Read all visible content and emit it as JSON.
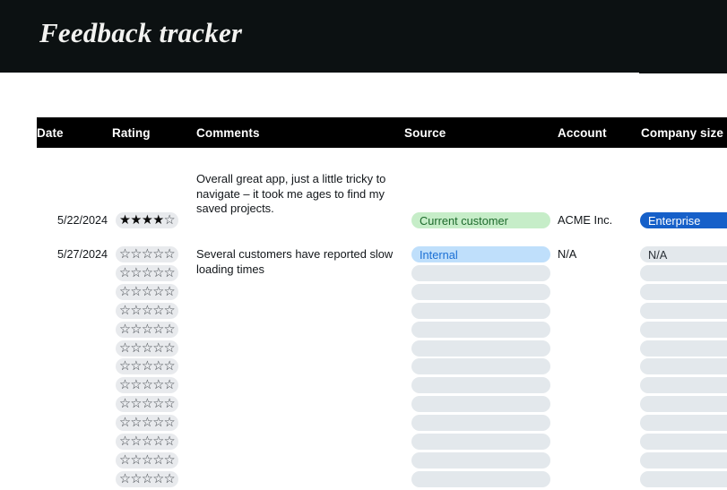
{
  "app": {
    "title": "Feedback tracker",
    "banner_color": "#0c1112"
  },
  "table": {
    "columns": [
      {
        "key": "date",
        "label": "Date"
      },
      {
        "key": "rating",
        "label": "Rating"
      },
      {
        "key": "comments",
        "label": "Comments"
      },
      {
        "key": "source",
        "label": "Source"
      },
      {
        "key": "account",
        "label": "Account"
      },
      {
        "key": "company",
        "label": "Company size"
      }
    ],
    "header_background": "#000000",
    "rows": [
      {
        "date": "5/22/2024",
        "rating": 4,
        "rating_max": 5,
        "comments": "Overall great app, just a little tricky to navigate – it took me ages to find my saved projects.",
        "source": "Current customer",
        "source_style": "green",
        "account": "ACME Inc.",
        "company": "Enterprise",
        "company_style": "navy"
      },
      {
        "date": "5/27/2024",
        "rating": 0,
        "rating_max": 5,
        "comments": "Several customers have reported slow loading times",
        "source": "Internal",
        "source_style": "blue",
        "account": "N/A",
        "company": "N/A",
        "company_style": "gray"
      }
    ],
    "empty_row_count": 12,
    "empty_row": {
      "date": "",
      "rating": 0,
      "rating_max": 5,
      "comments": "",
      "source": "",
      "source_style": "empty",
      "account": "",
      "company": "",
      "company_style": "empty"
    }
  },
  "icons": {
    "star_filled": "★",
    "star_empty": "☆"
  },
  "colors": {
    "pill_green_bg": "#c6edc8",
    "pill_green_text": "#1d6b2c",
    "pill_blue_bg": "#bfdffb",
    "pill_blue_text": "#1a6fd4",
    "pill_navy_bg": "#1660c9",
    "pill_navy_text": "#ffffff",
    "pill_gray_bg": "#e3e8ec",
    "star_pill_bg": "#e8eaed"
  }
}
